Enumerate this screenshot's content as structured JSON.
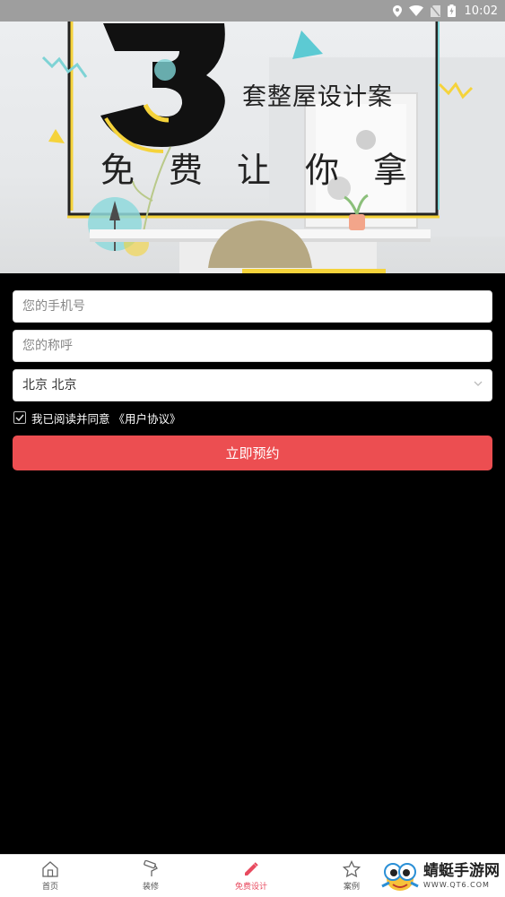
{
  "status_bar": {
    "time": "10:02"
  },
  "banner": {
    "number": "3",
    "line1": "套整屋设计案",
    "line2": "免费让你拿"
  },
  "form": {
    "phone_placeholder": "您的手机号",
    "name_placeholder": "您的称呼",
    "city_value": "北京 北京",
    "agree_text": "我已阅读并同意",
    "agree_link": "《用户协议》",
    "submit_label": "立即预约"
  },
  "bottom_nav": [
    {
      "label": "首页",
      "icon": "home-icon"
    },
    {
      "label": "装修",
      "icon": "paint-roller-icon"
    },
    {
      "label": "免费设计",
      "icon": "pencil-icon",
      "active": true
    },
    {
      "label": "案例",
      "icon": "star-icon"
    }
  ],
  "watermark": {
    "title": "蜻蜓手游网",
    "url": "WWW.QT6.COM"
  },
  "colors": {
    "accent": "#ec4e51",
    "nav_active": "#e84a5f"
  }
}
